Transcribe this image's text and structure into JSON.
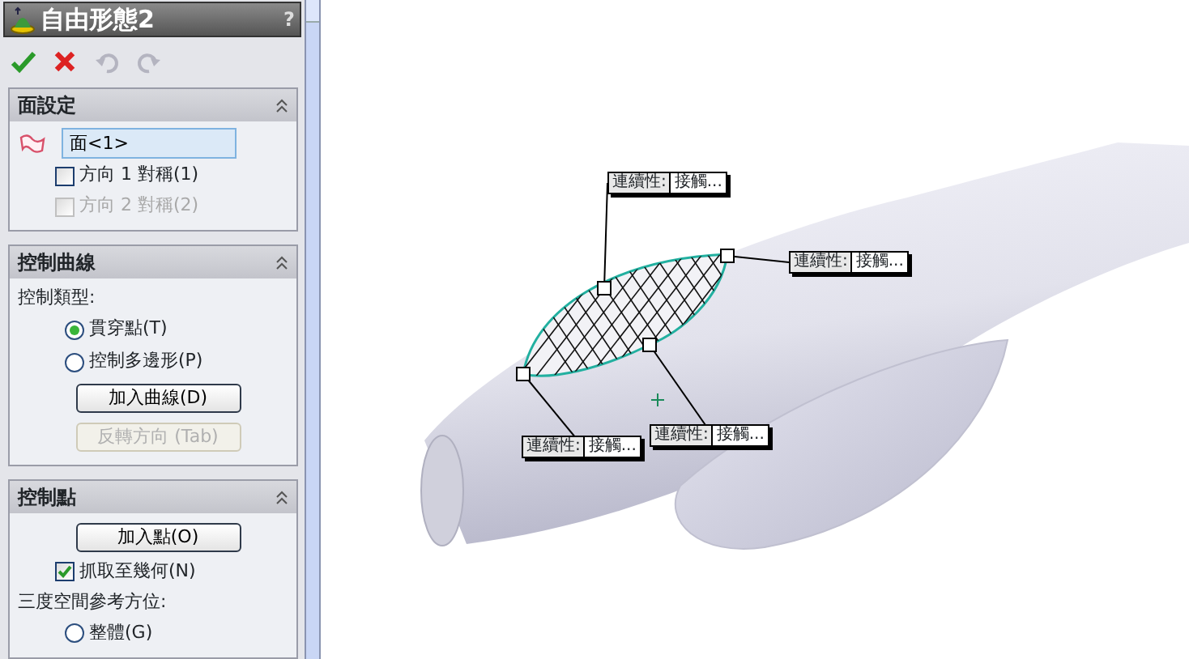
{
  "panel": {
    "title": "自由形態2",
    "help": "?",
    "toolbar": [
      {
        "kind": "ok",
        "disabled": false
      },
      {
        "kind": "cancel",
        "disabled": false
      },
      {
        "kind": "undo",
        "disabled": true
      },
      {
        "kind": "redo",
        "disabled": true
      }
    ],
    "sections": [
      {
        "title": "面設定",
        "items": [
          {
            "kind": "face_field",
            "value": "面<1>"
          },
          {
            "kind": "checkbox",
            "label": "方向 1 對稱(1)",
            "checked": false,
            "disabled": false
          },
          {
            "kind": "checkbox",
            "label": "方向 2 對稱(2)",
            "checked": false,
            "disabled": true
          }
        ]
      },
      {
        "title": "控制曲線",
        "items": [
          {
            "kind": "label",
            "text": "控制類型:"
          },
          {
            "kind": "radio",
            "label": "貫穿點(T)",
            "selected": true
          },
          {
            "kind": "radio",
            "label": "控制多邊形(P)",
            "selected": false
          },
          {
            "kind": "button",
            "label": "加入曲線(D)",
            "disabled": false
          },
          {
            "kind": "button",
            "label": "反轉方向 (Tab)",
            "disabled": true
          }
        ]
      },
      {
        "title": "控制點",
        "items": [
          {
            "kind": "button",
            "label": "加入點(O)",
            "disabled": false
          },
          {
            "kind": "checkbox",
            "label": "抓取至幾何(N)",
            "checked": true,
            "disabled": false
          },
          {
            "kind": "label",
            "text": "三度空間參考方位:"
          },
          {
            "kind": "radio",
            "label": "整體(G)",
            "selected": false
          }
        ]
      }
    ]
  },
  "viewport": {
    "callouts": [
      {
        "label": "連續性:",
        "value": "接觸..."
      },
      {
        "label": "連續性:",
        "value": "接觸..."
      },
      {
        "label": "連續性:",
        "value": "接觸..."
      },
      {
        "label": "連續性:",
        "value": "接觸..."
      }
    ]
  }
}
